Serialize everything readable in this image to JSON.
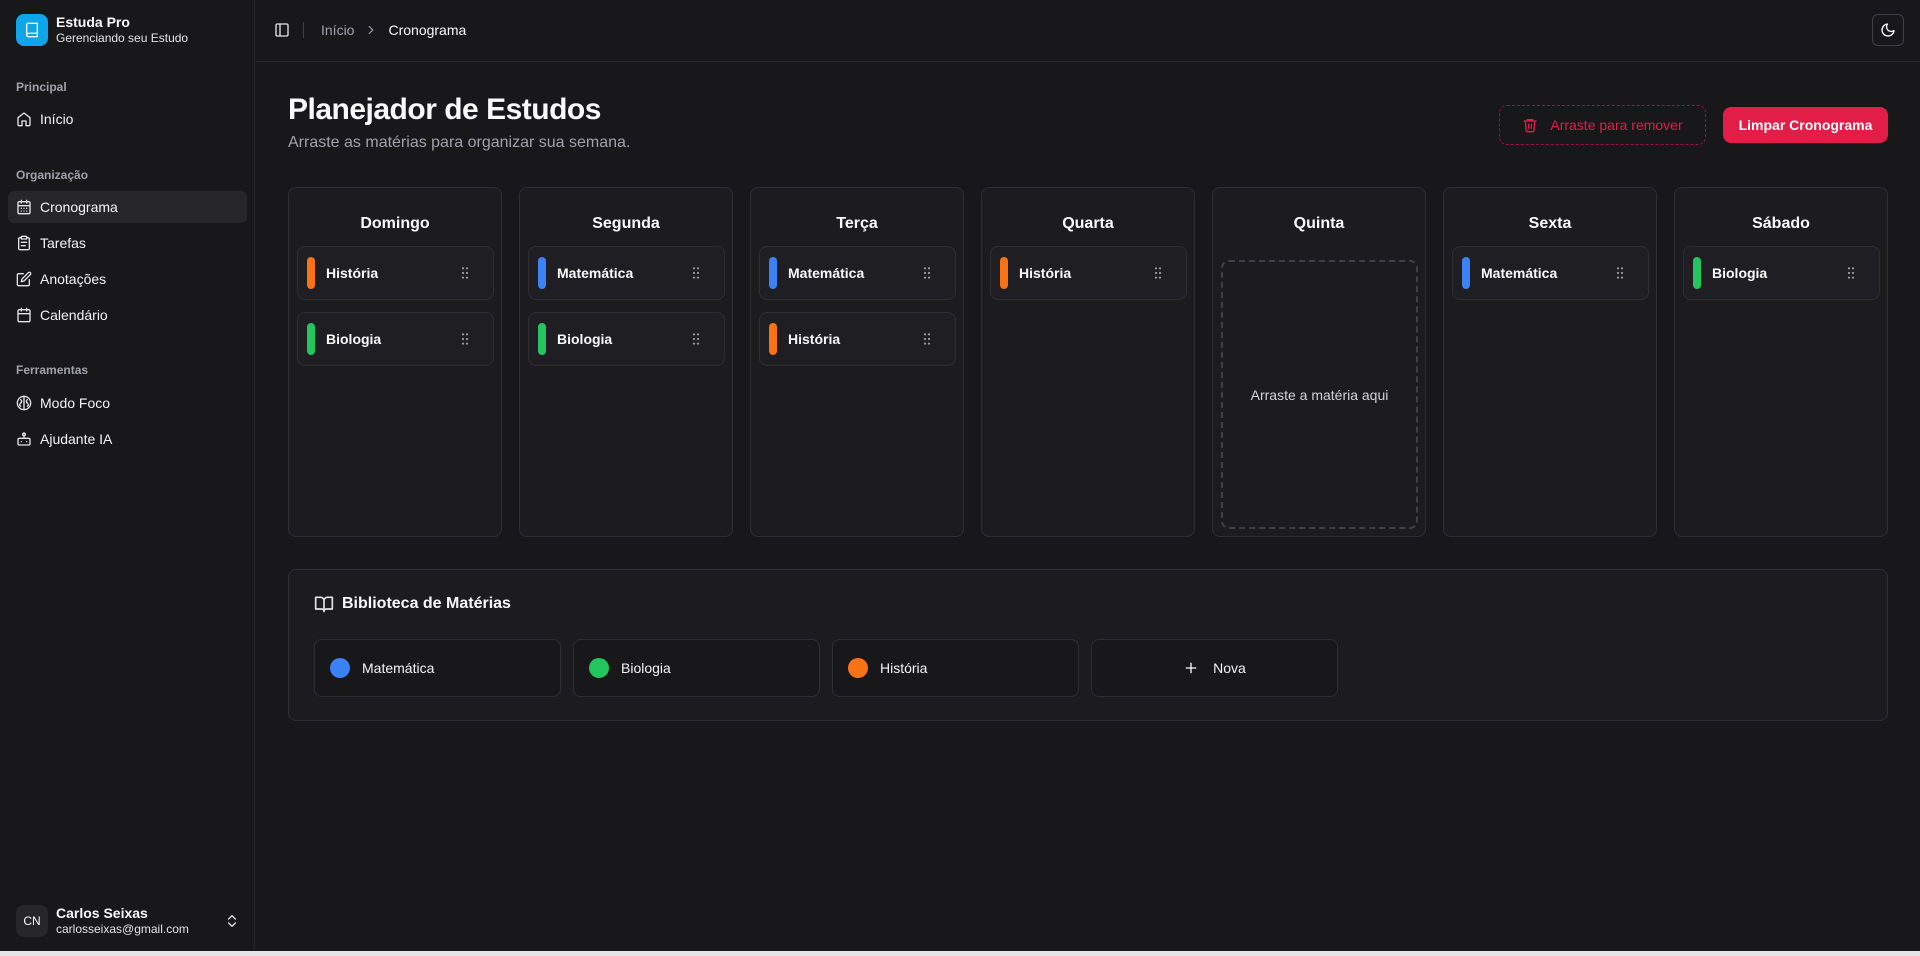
{
  "app": {
    "name": "Estuda Pro",
    "subtitle": "Gerenciando seu Estudo"
  },
  "sidebar": {
    "groups": [
      {
        "label": "Principal",
        "items": [
          {
            "label": "Início",
            "icon": "home-icon"
          }
        ]
      },
      {
        "label": "Organização",
        "items": [
          {
            "label": "Cronograma",
            "icon": "calendar-icon",
            "active": true
          },
          {
            "label": "Tarefas",
            "icon": "clipboard-icon"
          },
          {
            "label": "Anotações",
            "icon": "edit-icon"
          },
          {
            "label": "Calendário",
            "icon": "calendar-icon"
          }
        ]
      },
      {
        "label": "Ferramentas",
        "items": [
          {
            "label": "Modo Foco",
            "icon": "brain-icon"
          },
          {
            "label": "Ajudante IA",
            "icon": "bot-icon"
          }
        ]
      }
    ]
  },
  "user": {
    "initials": "CN",
    "name": "Carlos Seixas",
    "email": "carlosseixas@gmail.com"
  },
  "header": {
    "breadcrumb": [
      "Início",
      "Cronograma"
    ]
  },
  "main": {
    "title": "Planejador de Estudos",
    "subtitle": "Arraste as matérias para organizar sua semana.",
    "remove_zone_label": "Arraste para remover",
    "clear_button": "Limpar Cronograma"
  },
  "colors": {
    "Matemática": "#3b82f6",
    "Biologia": "#22c55e",
    "História": "#f97316",
    "accent": "#e11d48",
    "brand": "#0ea5e9"
  },
  "schedule": {
    "empty_label": "Arraste a matéria aqui",
    "days": [
      {
        "name": "Domingo",
        "subjects": [
          "História",
          "Biologia"
        ]
      },
      {
        "name": "Segunda",
        "subjects": [
          "Matemática",
          "Biologia"
        ]
      },
      {
        "name": "Terça",
        "subjects": [
          "Matemática",
          "História"
        ]
      },
      {
        "name": "Quarta",
        "subjects": [
          "História"
        ]
      },
      {
        "name": "Quinta",
        "subjects": []
      },
      {
        "name": "Sexta",
        "subjects": [
          "Matemática"
        ]
      },
      {
        "name": "Sábado",
        "subjects": [
          "Biologia"
        ]
      }
    ]
  },
  "library": {
    "title": "Biblioteca de Matérias",
    "subjects": [
      "Matemática",
      "Biologia",
      "História"
    ],
    "new_label": "Nova"
  }
}
